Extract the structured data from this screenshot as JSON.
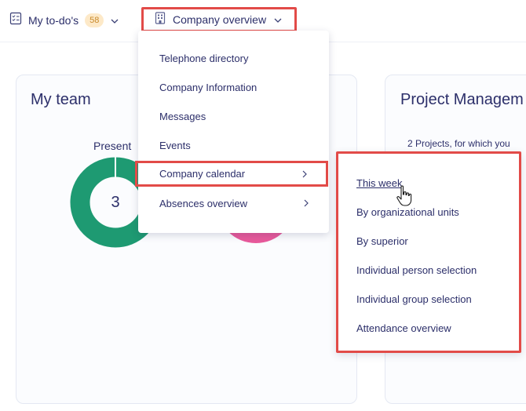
{
  "topbar": {
    "todo_label": "My to-do's",
    "todo_count": "58",
    "company_label": "Company overview"
  },
  "team_card": {
    "title": "My team",
    "present_label": "Present",
    "present_count": "3"
  },
  "project_card": {
    "title": "Project Managem",
    "subtitle": "2 Projects, for which you"
  },
  "company_menu": {
    "items": [
      {
        "label": "Telephone directory"
      },
      {
        "label": "Company Information"
      },
      {
        "label": "Messages"
      },
      {
        "label": "Events"
      },
      {
        "label": "Company calendar"
      },
      {
        "label": "Absences overview"
      }
    ]
  },
  "calendar_submenu": {
    "items": [
      {
        "label": "This week"
      },
      {
        "label": "By organizational units"
      },
      {
        "label": "By superior"
      },
      {
        "label": "Individual person selection"
      },
      {
        "label": "Individual group selection"
      },
      {
        "label": "Attendance overview"
      }
    ]
  },
  "colors": {
    "accent_red": "#e24b48",
    "present_green": "#1e9a72",
    "absent_pink": "#e85a9b",
    "text_navy": "#2c2f6a",
    "badge_bg": "#fde9c8"
  }
}
